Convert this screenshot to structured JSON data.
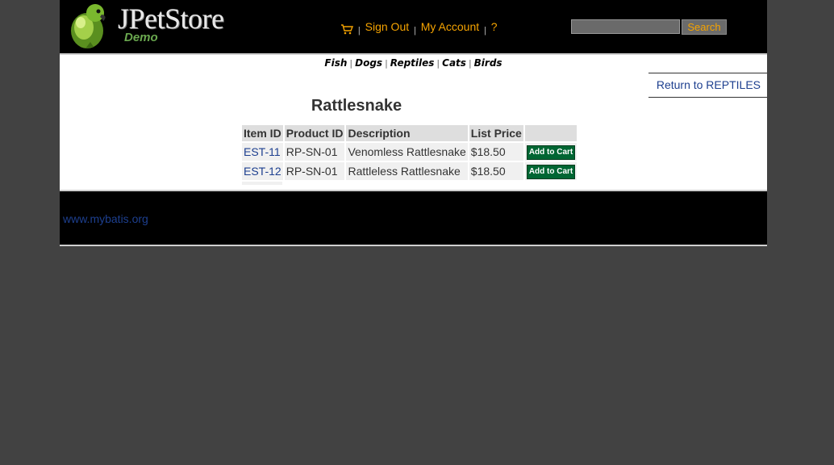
{
  "header": {
    "logo_title": "JPetStore",
    "logo_subtitle": "Demo",
    "menu": {
      "sign_out": "Sign Out",
      "my_account": "My Account",
      "help": "?",
      "separator": "|"
    },
    "search": {
      "value": "",
      "button_label": "Search"
    }
  },
  "quicklinks": {
    "fish": "Fish",
    "dogs": "Dogs",
    "reptiles": "Reptiles",
    "cats": "Cats",
    "birds": "Birds",
    "separator": "|"
  },
  "content": {
    "back_link": "Return to REPTILES",
    "product_name": "Rattlesnake",
    "table": {
      "headers": [
        "Item ID",
        "Product ID",
        "Description",
        "List Price",
        ""
      ],
      "rows": [
        {
          "item_id": "EST-11",
          "product_id": "RP-SN-01",
          "description": "Venomless Rattlesnake",
          "price": "$18.50",
          "action": "Add to Cart"
        },
        {
          "item_id": "EST-12",
          "product_id": "RP-SN-01",
          "description": "Rattleless Rattlesnake",
          "price": "$18.50",
          "action": "Add to Cart"
        }
      ]
    }
  },
  "footer": {
    "link": "www.mybatis.org"
  },
  "colors": {
    "background": "#424242",
    "header_bg": "#000000",
    "menu_link": "#f5a300",
    "link_blue": "#1d3f8f",
    "cart_button": "#006633"
  }
}
